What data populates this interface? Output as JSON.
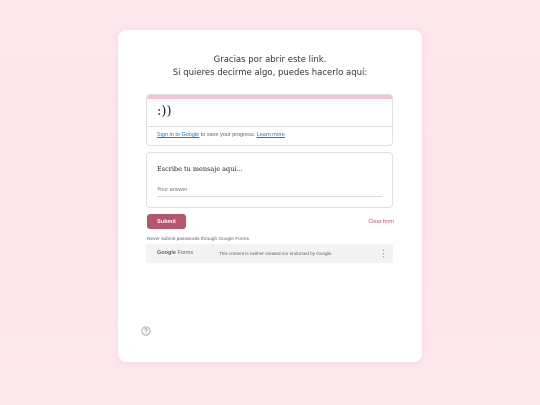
{
  "intro": {
    "line1": "Gracias por abrir este link.",
    "line2": "Si quieres decirme algo, puedes hacerlo aquí:"
  },
  "form": {
    "title": ":))",
    "signin_link": "Sign in to Google",
    "signin_middle": " to save your progress. ",
    "learn_more": "Learn more"
  },
  "question": {
    "label": "Escribe tu mensaje aquí...",
    "placeholder": "Your answer"
  },
  "actions": {
    "submit_label": "Submit",
    "clear_label": "Clear form"
  },
  "notice": "Never submit passwords through Google Forms.",
  "footer": {
    "logo_google": "Google",
    "logo_forms": " Forms",
    "disclaimer": "This content is neither created nor endorsed by Google."
  },
  "colors": {
    "accent": "#b5566f",
    "header_bar": "#f6c5d2",
    "page_background": "#fde6ec",
    "link": "#1a73e8"
  },
  "icons": {
    "more": "more-vert-icon",
    "help": "help-circle-icon"
  }
}
